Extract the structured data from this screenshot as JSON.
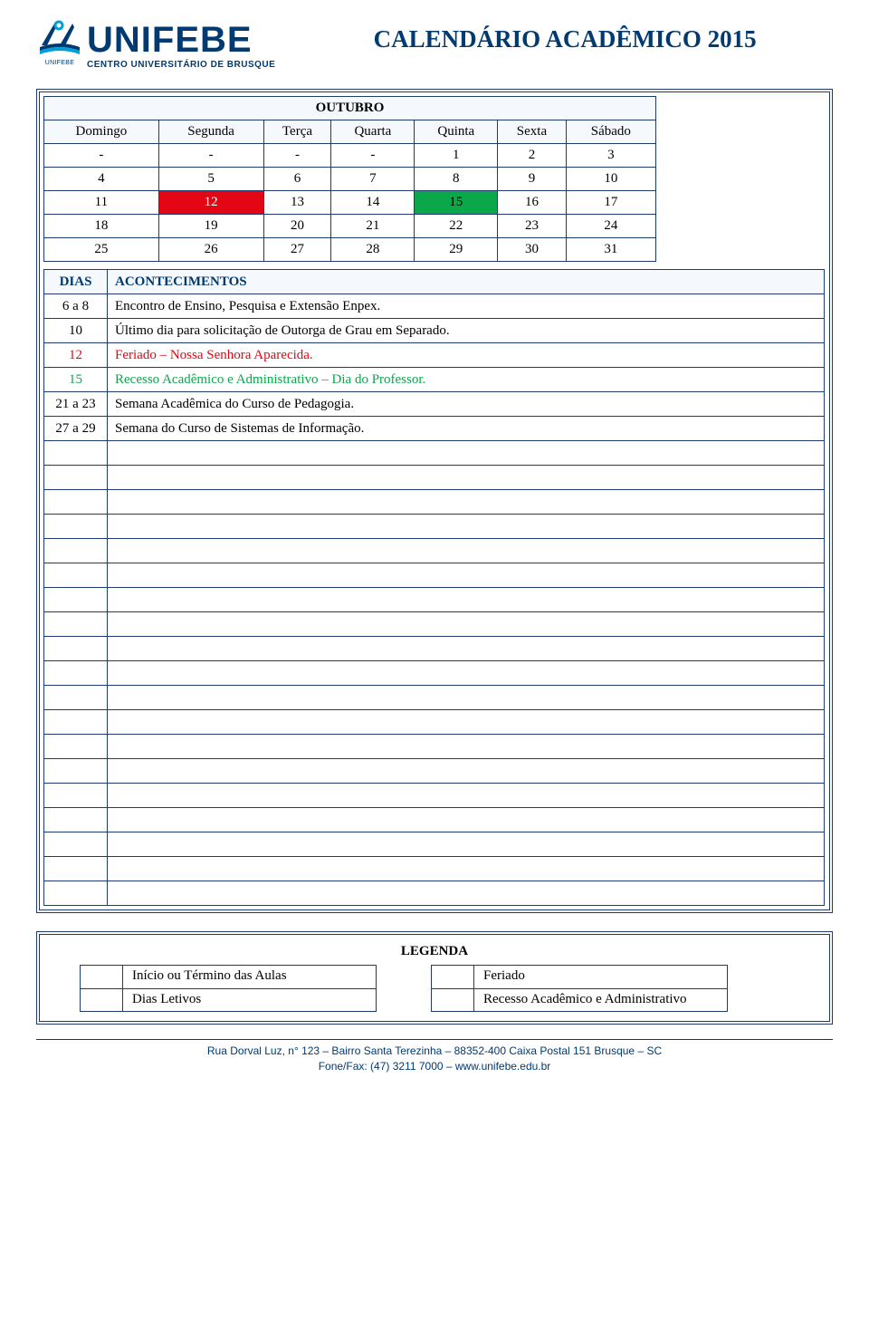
{
  "header": {
    "logo_sub": "UNIFEBE",
    "logo_title": "UNIFEBE",
    "logo_tagline": "CENTRO UNIVERSITÁRIO DE BRUSQUE",
    "doc_title": "CALENDÁRIO ACADÊMICO 2015"
  },
  "calendar": {
    "month": "OUTUBRO",
    "weekdays": [
      "Domingo",
      "Segunda",
      "Terça",
      "Quarta",
      "Quinta",
      "Sexta",
      "Sábado"
    ],
    "rows": [
      [
        {
          "v": "-"
        },
        {
          "v": "-"
        },
        {
          "v": "-"
        },
        {
          "v": "-"
        },
        {
          "v": "1"
        },
        {
          "v": "2"
        },
        {
          "v": "3"
        }
      ],
      [
        {
          "v": "4"
        },
        {
          "v": "5"
        },
        {
          "v": "6"
        },
        {
          "v": "7"
        },
        {
          "v": "8"
        },
        {
          "v": "9"
        },
        {
          "v": "10"
        }
      ],
      [
        {
          "v": "11"
        },
        {
          "v": "12",
          "cls": "cell-red"
        },
        {
          "v": "13"
        },
        {
          "v": "14"
        },
        {
          "v": "15",
          "cls": "cell-green"
        },
        {
          "v": "16"
        },
        {
          "v": "17"
        }
      ],
      [
        {
          "v": "18"
        },
        {
          "v": "19"
        },
        {
          "v": "20"
        },
        {
          "v": "21"
        },
        {
          "v": "22"
        },
        {
          "v": "23"
        },
        {
          "v": "24"
        }
      ],
      [
        {
          "v": "25"
        },
        {
          "v": "26"
        },
        {
          "v": "27"
        },
        {
          "v": "28"
        },
        {
          "v": "29"
        },
        {
          "v": "30"
        },
        {
          "v": "31"
        }
      ]
    ]
  },
  "events": {
    "head_dias": "DIAS",
    "head_acont": "ACONTECIMENTOS",
    "rows": [
      {
        "dias": "6 a 8",
        "text": "Encontro de Ensino, Pesquisa e Extensão Enpex.",
        "style": ""
      },
      {
        "dias": "10",
        "text": "Último dia para solicitação de Outorga de Grau em Separado.",
        "style": ""
      },
      {
        "dias": "12",
        "text": "Feriado – Nossa Senhora Aparecida.",
        "style": "red-text"
      },
      {
        "dias": "15",
        "text": "Recesso Acadêmico e Administrativo – Dia do Professor.",
        "style": "green-text"
      },
      {
        "dias": "21 a 23",
        "text": "Semana Acadêmica do Curso de Pedagogia.",
        "style": ""
      },
      {
        "dias": "27 a 29",
        "text": "Semana do Curso de Sistemas de Informação.",
        "style": ""
      }
    ],
    "empty_rows": 19
  },
  "legend": {
    "title": "LEGENDA",
    "left": [
      {
        "label": "Início ou Término das Aulas"
      },
      {
        "label": "Dias Letivos"
      }
    ],
    "right": [
      {
        "label": "Feriado"
      },
      {
        "label": "Recesso Acadêmico e Administrativo"
      }
    ]
  },
  "footer": {
    "line1": "Rua Dorval Luz, n° 123 – Bairro Santa Terezinha – 88352-400 Caixa Postal 151 Brusque – SC",
    "line2": "Fone/Fax: (47) 3211 7000 – www.unifebe.edu.br"
  }
}
